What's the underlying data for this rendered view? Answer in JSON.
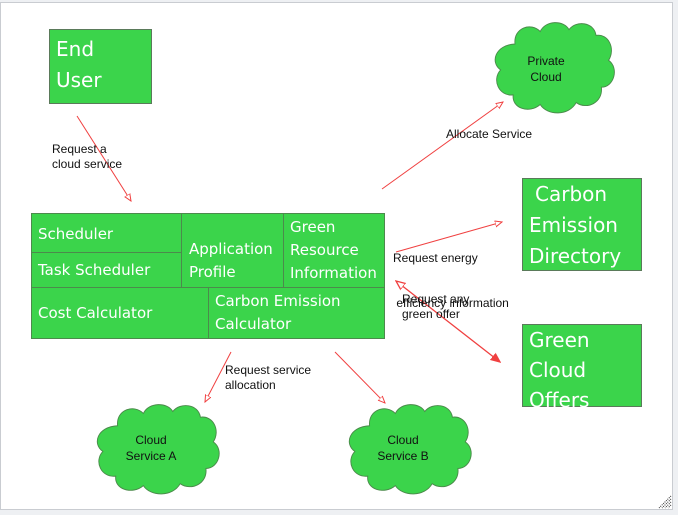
{
  "nodes": {
    "end_user": [
      "End",
      "User"
    ],
    "private_cloud": [
      "Private",
      "Cloud"
    ],
    "carbon_directory": [
      "Carbon",
      "Emission",
      "Directory"
    ],
    "green_offers": [
      "Green",
      "Cloud",
      "Offers"
    ],
    "cloud_a": [
      "Cloud",
      "Service A"
    ],
    "cloud_b": [
      "Cloud",
      "Service B"
    ]
  },
  "broker": {
    "scheduler": "Scheduler",
    "task_scheduler": "Task Scheduler",
    "app_profile": [
      "Application",
      "Profile"
    ],
    "green_resource": [
      "Green",
      "Resource",
      "Information"
    ],
    "cost_calculator": "Cost Calculator",
    "carbon_calculator": [
      "Carbon Emission",
      "Calculator"
    ]
  },
  "edges": {
    "request_cloud": [
      "Request a",
      "cloud service"
    ],
    "allocate": "Allocate Service",
    "energy": [
      "Request energy",
      " efficiency information"
    ],
    "green_offer": [
      "Request any",
      "green offer"
    ],
    "service_alloc": [
      "Request service",
      "allocation"
    ]
  },
  "colors": {
    "node_fill": "#3bd44b",
    "arrow": "#f04040"
  }
}
